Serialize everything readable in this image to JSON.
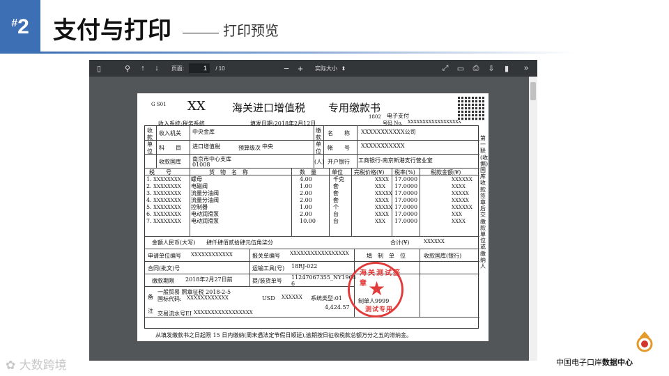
{
  "header": {
    "number": "2",
    "hash": "#",
    "title": "支付与打印",
    "subtitle": "打印预览"
  },
  "viewer": {
    "page_label": "页面:",
    "page_current": "1",
    "page_total": "/ 10",
    "zoom_label": "实际大小",
    "zoom_arrow": "⬍"
  },
  "doc": {
    "form_code": "G S01",
    "xx": "XX",
    "heading": "海关进口增值税",
    "heading2": "专用缴款书",
    "code_1802": "1802",
    "epay": "电子支付",
    "number_label": "号码 No.",
    "number_value": "XXXXXXXXXXXXXXXXXX",
    "recv_system": "收入系统:税务系统",
    "issue_date": "填发日期:2018年2月12日",
    "labels": {
      "payee_unit": "收款单位",
      "recv_org": "收入机关",
      "subject": "科　　目",
      "budget_level": "预算级次",
      "treasury": "收款国库",
      "payer_unit": "缴款单位",
      "name": "名　　称",
      "account": "帐　　号",
      "ren": "(人)",
      "bank": "开户银行"
    },
    "values": {
      "recv_org": "中央金库",
      "subject": "进口增值税",
      "budget_level": "中央",
      "treasury": "南京市中心支库",
      "treasury_code": "01008",
      "name": "XXXXXXXXXXX公司",
      "account": "XXXXXXXXXXX",
      "bank": "工商银行-南京新港支行营业室"
    },
    "item_headers": [
      "税　　号",
      "货　物　名　称",
      "数　量",
      "单位",
      "完税价格(¥)",
      "税率(%)",
      "税款金额(¥)"
    ],
    "items": [
      {
        "no": "1.",
        "tax": "XXXXXXXX",
        "name": "螺母",
        "qty": "4.00",
        "unit": "千克",
        "price": "XXXX",
        "rate": "17.0000",
        "amt": "XXXXXX"
      },
      {
        "no": "2.",
        "tax": "XXXXXXXX",
        "name": "电磁阀",
        "qty": "1.00",
        "unit": "套",
        "price": "XXX",
        "rate": "17.0000",
        "amt": "XXXX"
      },
      {
        "no": "3.",
        "tax": "XXXXXXXX",
        "name": "流量分油阀",
        "qty": "2.00",
        "unit": "套",
        "price": "XXXXX",
        "rate": "17.0000",
        "amt": "XXXXX"
      },
      {
        "no": "4.",
        "tax": "XXXXXXXX",
        "name": "流量分油阀",
        "qty": "2.00",
        "unit": "套",
        "price": "XXXX",
        "rate": "17.0000",
        "amt": "XXXXX"
      },
      {
        "no": "5.",
        "tax": "XXXXXXXX",
        "name": "控制器",
        "qty": "1.00",
        "unit": "个",
        "price": "XXXXX",
        "rate": "17.0000",
        "amt": "XXXXXX"
      },
      {
        "no": "6.",
        "tax": "XXXXXXXX",
        "name": "电动润滑泵",
        "qty": "2.00",
        "unit": "台",
        "price": "XXXX",
        "rate": "17.0000",
        "amt": "XXX"
      },
      {
        "no": "7.",
        "tax": "XXXXXXXX",
        "name": "电动润滑泵",
        "qty": "10.00",
        "unit": "台",
        "price": "XXX",
        "rate": "17.0000",
        "amt": "XXXX"
      }
    ],
    "amount_cny_label": "金额人民币(大写)",
    "amount_cny": "肆仟肆佰贰拾肆元伍角柒分",
    "total_label": "合计(¥)",
    "total_value": "XXXXXX",
    "applicant_no_label": "申请单位编号",
    "applicant_no": "XXXXXXXXXXXX",
    "declaration_no_label": "报关单编号",
    "declaration_no": "XXXXXXXXXXXXXXXXX",
    "fill_unit_label": "填　制　单　位",
    "treasury_bank_label": "收款国库(银行)",
    "contract_label": "合同(批文)号",
    "transport_label": "运输工具(号)",
    "transport": "18RJ-022",
    "deadline_label": "缴款期限",
    "deadline": "2018年2月27日前",
    "bill_label": "提/装货单号",
    "bill_no": "11247067355_NY1968",
    "bill_no2": "6",
    "remarks_label1": "备",
    "remarks_label2": "注",
    "remarks1": "一般贸易 照章征税 2018-2-5",
    "remarks2_label": "国标代码:",
    "remarks2": "XXXXXXXXXXXX",
    "usd": "USD",
    "usd_value": "XXXXXX",
    "system_cat": "系统类型:01",
    "amount_short": "4,424.57",
    "maker": "制单人9999",
    "serial_label": "交易流水号EI",
    "serial": "XXXXXXXXXXXXXXXXX",
    "footnote": "从填发缴款书之日起限 15 日内缴纳(周末遇法定节假日顺延),逾期按日征收税款总额万分之五的滞纳金。",
    "side_text": "第一联(收据)国库收款签章后交缴款单位或缴纳人",
    "stamp_top": "海关测试签章",
    "stamp_bottom": "测试专用",
    "stamp_star": "★"
  },
  "footer": {
    "watermark": "大数跨境",
    "brand_normal": "中国电子口岸",
    "brand_bold": "数据中心"
  },
  "colors": {
    "accent": "#3d6fb4",
    "viewer_bg": "#525659",
    "toolbar_bg": "#323639",
    "stamp": "#e23b3b"
  }
}
